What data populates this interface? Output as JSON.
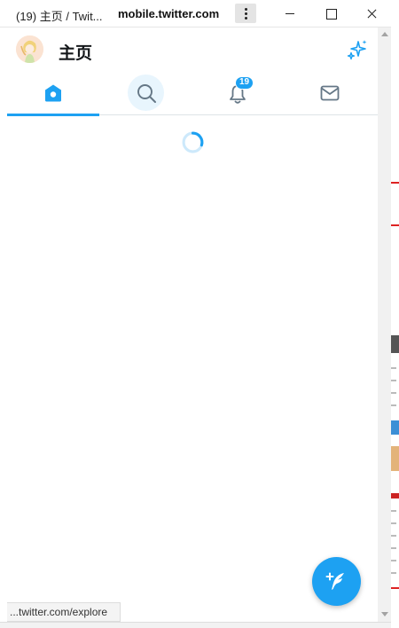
{
  "window": {
    "title": "(19) 主页 / Twit...",
    "url": "mobile.twitter.com"
  },
  "header": {
    "title": "主页"
  },
  "tabs": [
    {
      "name": "home",
      "icon": "home-icon",
      "active": true
    },
    {
      "name": "search",
      "icon": "search-icon",
      "active": false
    },
    {
      "name": "notifications",
      "icon": "bell-icon",
      "badge": "19",
      "active": false
    },
    {
      "name": "messages",
      "icon": "mail-icon",
      "active": false
    }
  ],
  "statusbar": {
    "link": "...twitter.com/explore"
  },
  "colors": {
    "accent": "#1da1f2",
    "icon_gray": "#657786",
    "text": "#14171a"
  }
}
